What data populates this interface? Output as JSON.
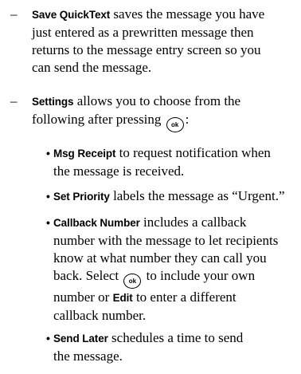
{
  "dash_symbol": "–",
  "bullet_symbol": "•",
  "ok_icon_label": "ok",
  "items": {
    "save_quicktext": {
      "term": "Save QuickText",
      "line1": " saves the message you have",
      "line2": "just entered as a prewritten message then",
      "line3": "returns to the message entry screen so you",
      "line4": "can send the message."
    },
    "settings": {
      "term": "Settings",
      "line1": " allows you to choose from the",
      "line2_before": "following after pressing ",
      "line2_after": ":"
    },
    "msg_receipt": {
      "term": "Msg Receipt",
      "line1": " to request notification when",
      "line2": "the message is received."
    },
    "set_priority": {
      "term": "Set Priority",
      "line1": " labels the message as “Urgent.”"
    },
    "callback_number": {
      "term": "Callback Number",
      "line1": " includes a callback",
      "line2": "number with the message to let recipients",
      "line3": "know at what number they can call you",
      "line4_before": "back. Select ",
      "line4_after": " to include your own",
      "line5_before": "number or ",
      "edit_term": "Edit",
      "line5_after": " to enter a different",
      "line6": "callback number."
    },
    "send_later": {
      "term": "Send Later",
      "line1": " schedules a time to send",
      "line2": "the message."
    }
  }
}
